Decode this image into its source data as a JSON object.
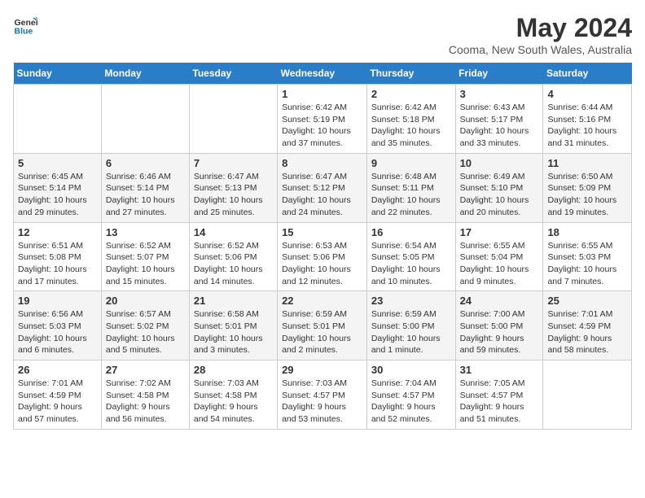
{
  "header": {
    "logo_line1": "General",
    "logo_line2": "Blue",
    "month_year": "May 2024",
    "location": "Cooma, New South Wales, Australia"
  },
  "weekdays": [
    "Sunday",
    "Monday",
    "Tuesday",
    "Wednesday",
    "Thursday",
    "Friday",
    "Saturday"
  ],
  "weeks": [
    [
      {
        "day": "",
        "info": ""
      },
      {
        "day": "",
        "info": ""
      },
      {
        "day": "",
        "info": ""
      },
      {
        "day": "1",
        "info": "Sunrise: 6:42 AM\nSunset: 5:19 PM\nDaylight: 10 hours\nand 37 minutes."
      },
      {
        "day": "2",
        "info": "Sunrise: 6:42 AM\nSunset: 5:18 PM\nDaylight: 10 hours\nand 35 minutes."
      },
      {
        "day": "3",
        "info": "Sunrise: 6:43 AM\nSunset: 5:17 PM\nDaylight: 10 hours\nand 33 minutes."
      },
      {
        "day": "4",
        "info": "Sunrise: 6:44 AM\nSunset: 5:16 PM\nDaylight: 10 hours\nand 31 minutes."
      }
    ],
    [
      {
        "day": "5",
        "info": "Sunrise: 6:45 AM\nSunset: 5:14 PM\nDaylight: 10 hours\nand 29 minutes."
      },
      {
        "day": "6",
        "info": "Sunrise: 6:46 AM\nSunset: 5:14 PM\nDaylight: 10 hours\nand 27 minutes."
      },
      {
        "day": "7",
        "info": "Sunrise: 6:47 AM\nSunset: 5:13 PM\nDaylight: 10 hours\nand 25 minutes."
      },
      {
        "day": "8",
        "info": "Sunrise: 6:47 AM\nSunset: 5:12 PM\nDaylight: 10 hours\nand 24 minutes."
      },
      {
        "day": "9",
        "info": "Sunrise: 6:48 AM\nSunset: 5:11 PM\nDaylight: 10 hours\nand 22 minutes."
      },
      {
        "day": "10",
        "info": "Sunrise: 6:49 AM\nSunset: 5:10 PM\nDaylight: 10 hours\nand 20 minutes."
      },
      {
        "day": "11",
        "info": "Sunrise: 6:50 AM\nSunset: 5:09 PM\nDaylight: 10 hours\nand 19 minutes."
      }
    ],
    [
      {
        "day": "12",
        "info": "Sunrise: 6:51 AM\nSunset: 5:08 PM\nDaylight: 10 hours\nand 17 minutes."
      },
      {
        "day": "13",
        "info": "Sunrise: 6:52 AM\nSunset: 5:07 PM\nDaylight: 10 hours\nand 15 minutes."
      },
      {
        "day": "14",
        "info": "Sunrise: 6:52 AM\nSunset: 5:06 PM\nDaylight: 10 hours\nand 14 minutes."
      },
      {
        "day": "15",
        "info": "Sunrise: 6:53 AM\nSunset: 5:06 PM\nDaylight: 10 hours\nand 12 minutes."
      },
      {
        "day": "16",
        "info": "Sunrise: 6:54 AM\nSunset: 5:05 PM\nDaylight: 10 hours\nand 10 minutes."
      },
      {
        "day": "17",
        "info": "Sunrise: 6:55 AM\nSunset: 5:04 PM\nDaylight: 10 hours\nand 9 minutes."
      },
      {
        "day": "18",
        "info": "Sunrise: 6:55 AM\nSunset: 5:03 PM\nDaylight: 10 hours\nand 7 minutes."
      }
    ],
    [
      {
        "day": "19",
        "info": "Sunrise: 6:56 AM\nSunset: 5:03 PM\nDaylight: 10 hours\nand 6 minutes."
      },
      {
        "day": "20",
        "info": "Sunrise: 6:57 AM\nSunset: 5:02 PM\nDaylight: 10 hours\nand 5 minutes."
      },
      {
        "day": "21",
        "info": "Sunrise: 6:58 AM\nSunset: 5:01 PM\nDaylight: 10 hours\nand 3 minutes."
      },
      {
        "day": "22",
        "info": "Sunrise: 6:59 AM\nSunset: 5:01 PM\nDaylight: 10 hours\nand 2 minutes."
      },
      {
        "day": "23",
        "info": "Sunrise: 6:59 AM\nSunset: 5:00 PM\nDaylight: 10 hours\nand 1 minute."
      },
      {
        "day": "24",
        "info": "Sunrise: 7:00 AM\nSunset: 5:00 PM\nDaylight: 9 hours\nand 59 minutes."
      },
      {
        "day": "25",
        "info": "Sunrise: 7:01 AM\nSunset: 4:59 PM\nDaylight: 9 hours\nand 58 minutes."
      }
    ],
    [
      {
        "day": "26",
        "info": "Sunrise: 7:01 AM\nSunset: 4:59 PM\nDaylight: 9 hours\nand 57 minutes."
      },
      {
        "day": "27",
        "info": "Sunrise: 7:02 AM\nSunset: 4:58 PM\nDaylight: 9 hours\nand 56 minutes."
      },
      {
        "day": "28",
        "info": "Sunrise: 7:03 AM\nSunset: 4:58 PM\nDaylight: 9 hours\nand 54 minutes."
      },
      {
        "day": "29",
        "info": "Sunrise: 7:03 AM\nSunset: 4:57 PM\nDaylight: 9 hours\nand 53 minutes."
      },
      {
        "day": "30",
        "info": "Sunrise: 7:04 AM\nSunset: 4:57 PM\nDaylight: 9 hours\nand 52 minutes."
      },
      {
        "day": "31",
        "info": "Sunrise: 7:05 AM\nSunset: 4:57 PM\nDaylight: 9 hours\nand 51 minutes."
      },
      {
        "day": "",
        "info": ""
      }
    ]
  ]
}
